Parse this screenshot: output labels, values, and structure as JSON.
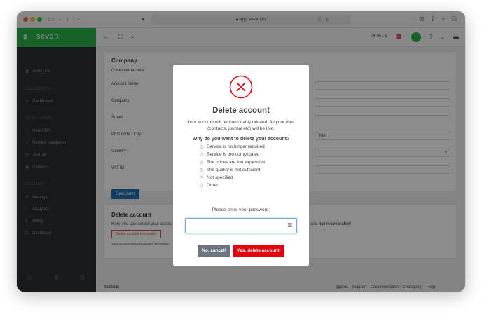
{
  "browser": {
    "url": "app.seven.io"
  },
  "brand": {
    "name": "seven",
    "color": "#2bb24c"
  },
  "sidebar": {
    "account": "acme_inc",
    "sections": [
      {
        "heading": "ALLGEMEIN",
        "items": [
          {
            "label": "Dashboard",
            "icon": "dashboard-icon"
          }
        ]
      },
      {
        "heading": "MESSAGING",
        "items": [
          {
            "label": "New SMS",
            "icon": "chat-icon"
          },
          {
            "label": "Number validation",
            "icon": "check-icon"
          },
          {
            "label": "Journal",
            "icon": "journal-icon"
          },
          {
            "label": "Contacts",
            "icon": "contacts-icon"
          }
        ]
      },
      {
        "heading": "ACCOUNT",
        "items": [
          {
            "label": "Settings",
            "icon": "gear-icon"
          },
          {
            "label": "Analytics",
            "icon": "chart-icon"
          },
          {
            "label": "Billing",
            "icon": "euro-icon"
          },
          {
            "label": "Developer",
            "icon": "code-icon"
          }
        ]
      }
    ]
  },
  "header": {
    "balance": "74,057 €"
  },
  "company_card": {
    "title": "Company",
    "customer_number_label": "Customer number",
    "account_name_label": "Account name",
    "company_label": "Company",
    "street_label": "Street",
    "postcode_city_label": "Post code / City",
    "city_value": "Kiel",
    "country_label": "Country",
    "vat_label": "VAT ID",
    "save_button": "Speichern"
  },
  "delete_card": {
    "title": "Delete account",
    "text_start": "Here you can cancel your accou",
    "text_end_prefix": "and ",
    "text_end_bold": "not recoverable",
    "text_end_suffix": "!",
    "button": "Delete account irrevocably",
    "note": "Your account gets deactivated immediate"
  },
  "footer": {
    "copyright_prefix": "© 2023 ",
    "copyright_link": "seven.io",
    "links": "Status · Support · Documentation · Changelog · Help"
  },
  "modal": {
    "title": "Delete account",
    "message": "Your account will be irrevocably deleted. All your data (contacts, journal etc) will be lost.",
    "question": "Why do you want to delete your account?",
    "reasons": [
      "Service is no longer required",
      "Service is too complicated",
      "The prices are too expensive",
      "The quality is not sufficient",
      "Not specified",
      "Other"
    ],
    "password_prompt": "Please enter your password:",
    "password_value": "",
    "cancel_button": "No, cancel!",
    "confirm_button": "Yes, delete account!",
    "colors": {
      "danger": "#e3000f",
      "cancel": "#6c757d"
    }
  }
}
